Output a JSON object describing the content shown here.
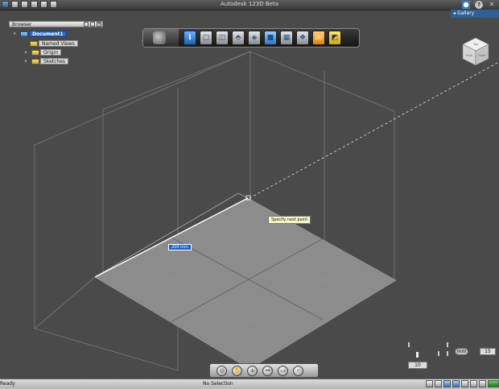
{
  "app": {
    "title": "Autodesk 123D Beta"
  },
  "top_right": {
    "gallery_label": "Gallery",
    "help_glyph": "?",
    "close_glyph": "✕"
  },
  "browser": {
    "title": "Browser",
    "items": [
      {
        "label": "Document1",
        "selected": true
      },
      {
        "label": "Named Views"
      },
      {
        "label": "Origin"
      },
      {
        "label": "Sketches"
      }
    ]
  },
  "toolbar": {
    "icons": [
      "info-icon",
      "box-icon",
      "cylinder-icon",
      "extrude-icon",
      "sweep-icon",
      "combine-icon",
      "pattern-icon",
      "group-icon",
      "2d-sketch-icon",
      "material-icon"
    ]
  },
  "viewcube": {
    "top": "Top",
    "front": "Front",
    "right": "Right"
  },
  "canvas": {
    "tooltip": "Specify next point",
    "dimension": "200 mm"
  },
  "units": {
    "unit_label": "mm",
    "value_right": "15",
    "value_bottom": "10"
  },
  "status": {
    "left": "Ready",
    "center": "No Selection"
  }
}
